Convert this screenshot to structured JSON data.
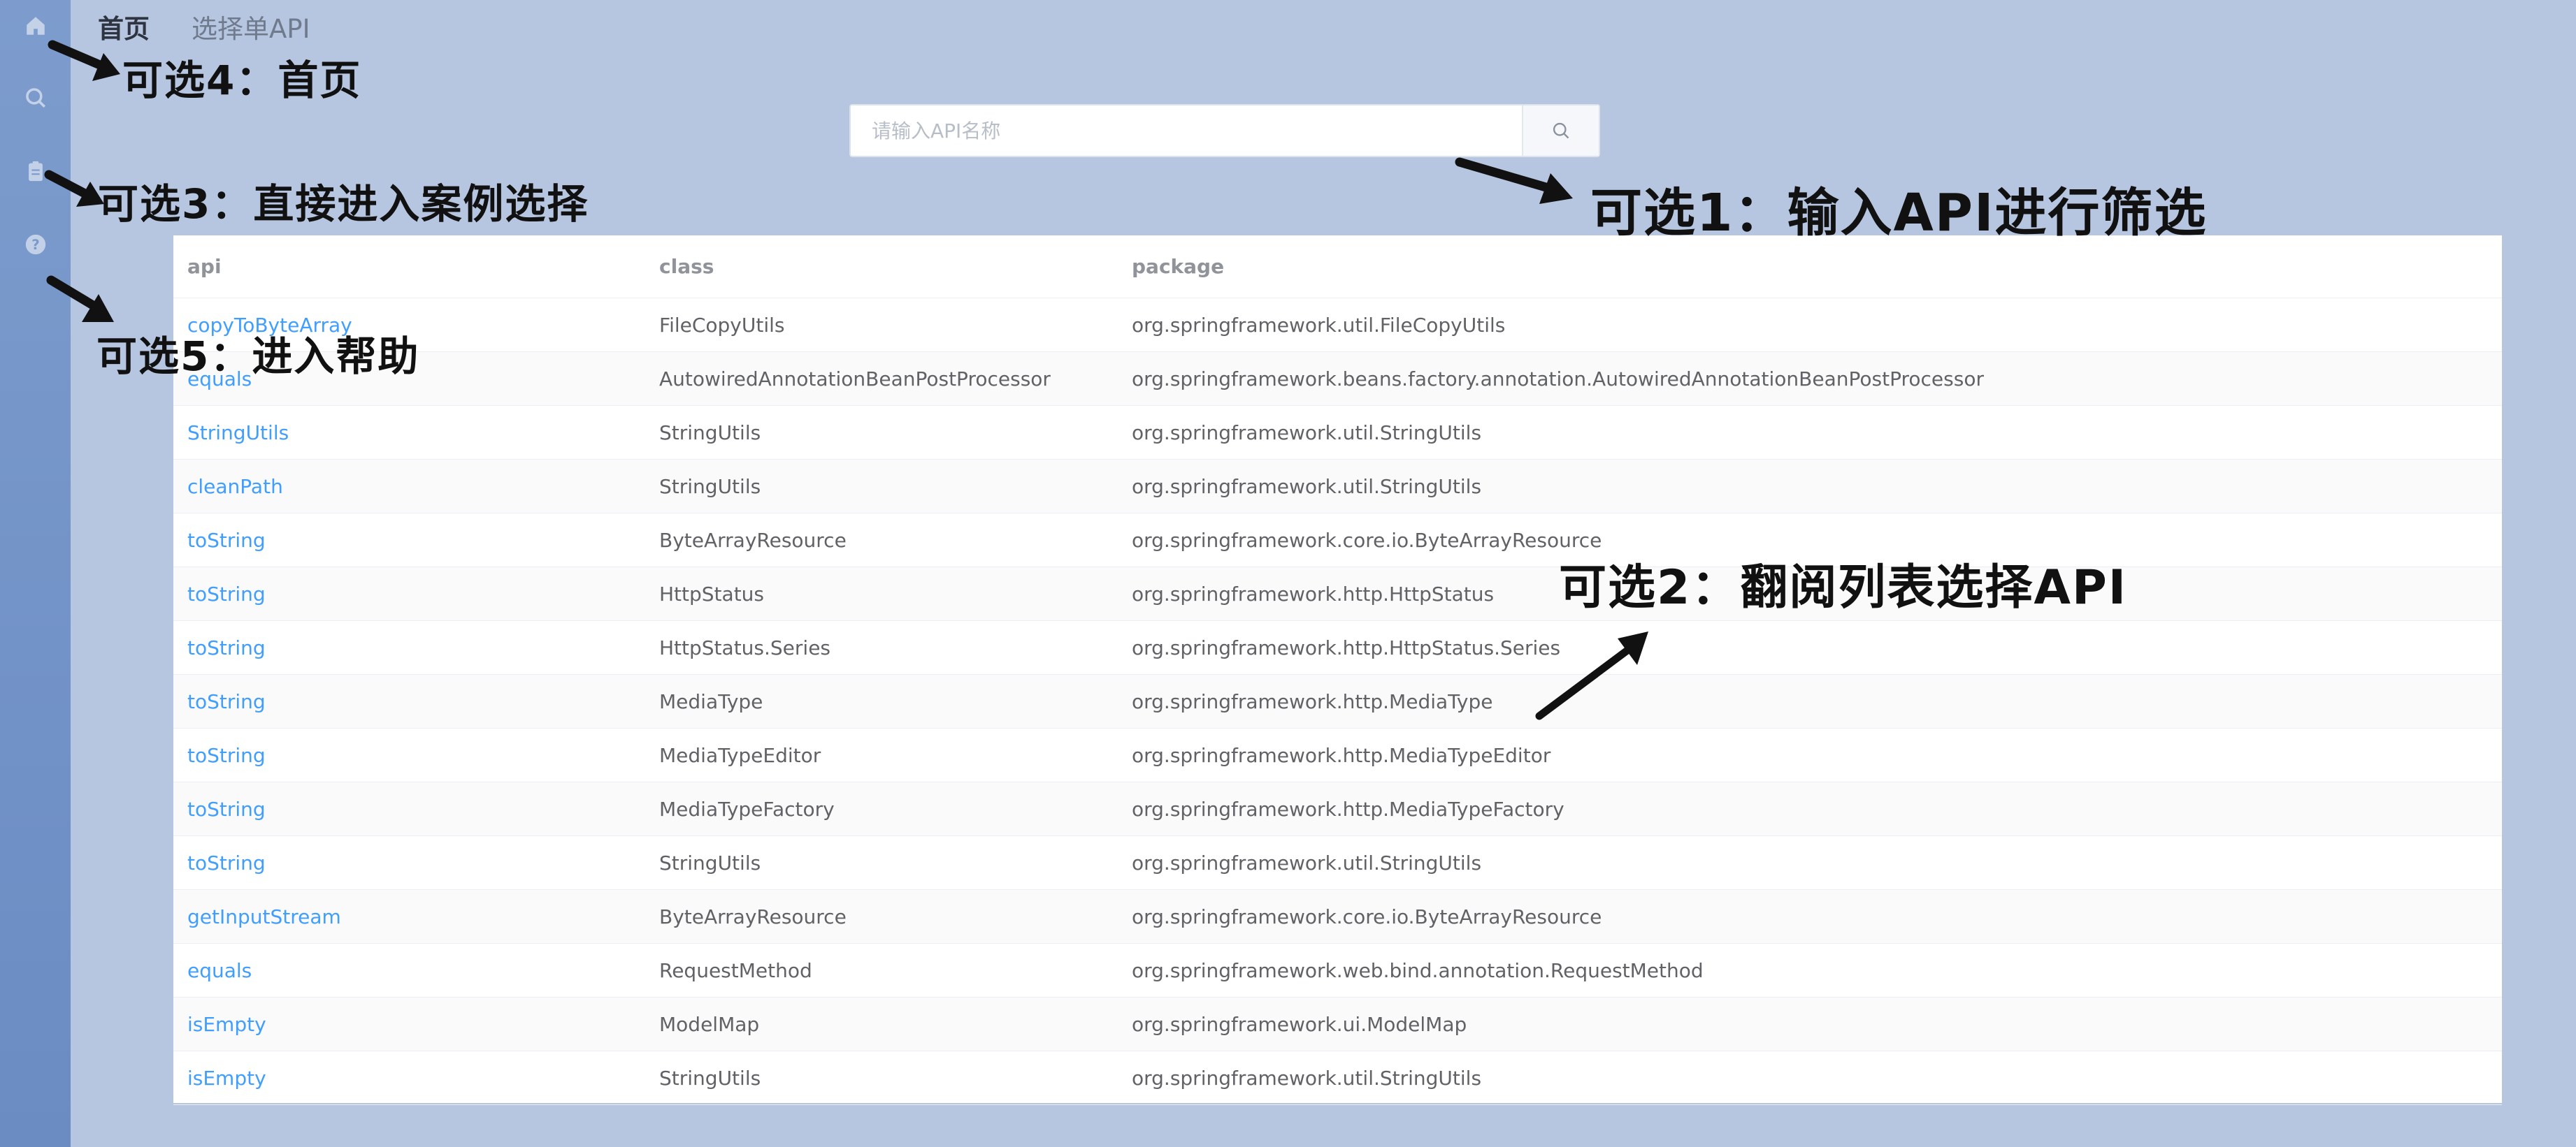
{
  "nav": {
    "home": "首页",
    "select_api": "选择单API"
  },
  "search": {
    "placeholder": "请输入API名称"
  },
  "table": {
    "headers": {
      "api": "api",
      "class": "class",
      "package": "package"
    },
    "rows": [
      {
        "api": "copyToByteArray",
        "class": "FileCopyUtils",
        "package": "org.springframework.util.FileCopyUtils"
      },
      {
        "api": "equals",
        "class": "AutowiredAnnotationBeanPostProcessor",
        "package": "org.springframework.beans.factory.annotation.AutowiredAnnotationBeanPostProcessor"
      },
      {
        "api": "StringUtils",
        "class": "StringUtils",
        "package": "org.springframework.util.StringUtils"
      },
      {
        "api": "cleanPath",
        "class": "StringUtils",
        "package": "org.springframework.util.StringUtils"
      },
      {
        "api": "toString",
        "class": "ByteArrayResource",
        "package": "org.springframework.core.io.ByteArrayResource"
      },
      {
        "api": "toString",
        "class": "HttpStatus",
        "package": "org.springframework.http.HttpStatus"
      },
      {
        "api": "toString",
        "class": "HttpStatus.Series",
        "package": "org.springframework.http.HttpStatus.Series"
      },
      {
        "api": "toString",
        "class": "MediaType",
        "package": "org.springframework.http.MediaType"
      },
      {
        "api": "toString",
        "class": "MediaTypeEditor",
        "package": "org.springframework.http.MediaTypeEditor"
      },
      {
        "api": "toString",
        "class": "MediaTypeFactory",
        "package": "org.springframework.http.MediaTypeFactory"
      },
      {
        "api": "toString",
        "class": "StringUtils",
        "package": "org.springframework.util.StringUtils"
      },
      {
        "api": "getInputStream",
        "class": "ByteArrayResource",
        "package": "org.springframework.core.io.ByteArrayResource"
      },
      {
        "api": "equals",
        "class": "RequestMethod",
        "package": "org.springframework.web.bind.annotation.RequestMethod"
      },
      {
        "api": "isEmpty",
        "class": "ModelMap",
        "package": "org.springframework.ui.ModelMap"
      },
      {
        "api": "isEmpty",
        "class": "StringUtils",
        "package": "org.springframework.util.StringUtils"
      }
    ]
  },
  "annotations": {
    "opt4": "可选4：首页",
    "opt3": "可选3：直接进入案例选择",
    "opt5": "可选5：进入帮助",
    "opt1": "可选1：输入API进行筛选",
    "opt2": "可选2：翻阅列表选择API"
  },
  "sidebar": {
    "icons": [
      "home-icon",
      "search-icon",
      "clipboard-icon",
      "help-icon"
    ]
  }
}
